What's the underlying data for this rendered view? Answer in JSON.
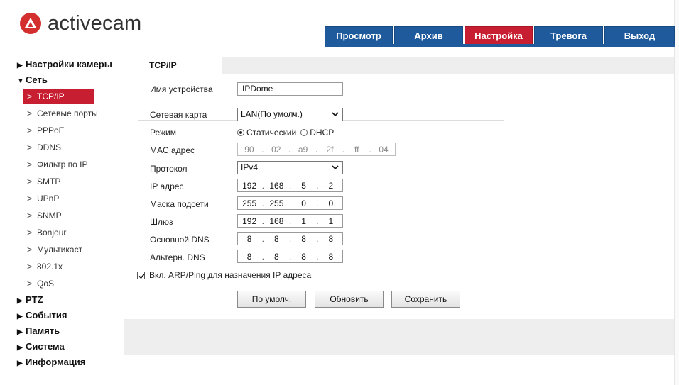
{
  "brand": {
    "name": "activecam",
    "accent": "#c81e32",
    "nav_blue": "#1e5a9c"
  },
  "nav": [
    {
      "label": "Просмотр",
      "active": false
    },
    {
      "label": "Архив",
      "active": false
    },
    {
      "label": "Настройка",
      "active": true
    },
    {
      "label": "Тревога",
      "active": false
    },
    {
      "label": "Выход",
      "active": false
    }
  ],
  "sidebar": {
    "camera_settings": "Настройки камеры",
    "network": "Сеть",
    "network_items": [
      "TCP/IP",
      "Сетевые порты",
      "PPPoE",
      "DDNS",
      "Фильтр по IP",
      "SMTP",
      "UPnP",
      "SNMP",
      "Bonjour",
      "Мультикаст",
      "802.1x",
      "QoS"
    ],
    "ptz": "PTZ",
    "events": "События",
    "storage": "Память",
    "system": "Система",
    "info": "Информация"
  },
  "content": {
    "tab": "TCP/IP",
    "device_name": {
      "label": "Имя устройства",
      "value": "IPDome"
    },
    "nic": {
      "label": "Сетевая карта",
      "value": "LAN(По умолч.)"
    },
    "mode": {
      "label": "Режим",
      "static": "Статический",
      "dhcp": "DHCP",
      "selected": "static"
    },
    "mac": {
      "label": "MAC адрес",
      "octets": [
        "90",
        "02",
        "a9",
        "2f",
        "ff",
        "04"
      ]
    },
    "protocol": {
      "label": "Протокол",
      "value": "IPv4"
    },
    "ip": {
      "label": "IP адрес",
      "octets": [
        "192",
        "168",
        "5",
        "2"
      ]
    },
    "mask": {
      "label": "Маска подсети",
      "octets": [
        "255",
        "255",
        "0",
        "0"
      ]
    },
    "gateway": {
      "label": "Шлюз",
      "octets": [
        "192",
        "168",
        "1",
        "1"
      ]
    },
    "dns1": {
      "label": "Основной DNS",
      "octets": [
        "8",
        "8",
        "8",
        "8"
      ]
    },
    "dns2": {
      "label": "Альтерн. DNS",
      "octets": [
        "8",
        "8",
        "8",
        "8"
      ]
    },
    "arp": {
      "label": "Вкл. ARP/Ping для назначения IP адреса",
      "checked": true
    },
    "buttons": {
      "default": "По умолч.",
      "refresh": "Обновить",
      "save": "Сохранить"
    }
  }
}
